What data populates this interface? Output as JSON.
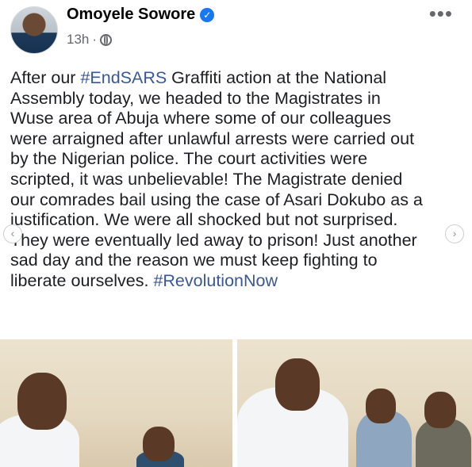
{
  "author": {
    "name": "Omoyele Sowore",
    "verified_mark": "✓",
    "timestamp": "13h",
    "separator": "·",
    "privacy_icon": "globe-icon"
  },
  "menu": {
    "more_glyph": "•••"
  },
  "post": {
    "segments": [
      {
        "text": "After our ",
        "hashtag": false
      },
      {
        "text": "#EndSARS",
        "hashtag": true
      },
      {
        "text": " Graffiti action at the National\nAssembly today, we headed to the Magistrates in\nWuse area of Abuja where some of our colleagues\nwere arraigned after unlawful arrests were carried out\nby the Nigerian police. The court activities were\nscripted, it was unbelievable! The Magistrate denied\nour comrades bail using the case of Asari Dokubo as a\njustification. We were all shocked  but not surprised.\nThey were eventually led away to prison! Just another\nsad day and the reason we must keep fighting to\nliberate ourselves. ",
        "hashtag": false
      },
      {
        "text": "#RevolutionNow",
        "hashtag": true
      }
    ]
  },
  "nav": {
    "prev_glyph": "‹",
    "next_glyph": "›"
  },
  "colors": {
    "hashtag": "#385898",
    "verified": "#1877f2",
    "meta": "#65676b"
  }
}
